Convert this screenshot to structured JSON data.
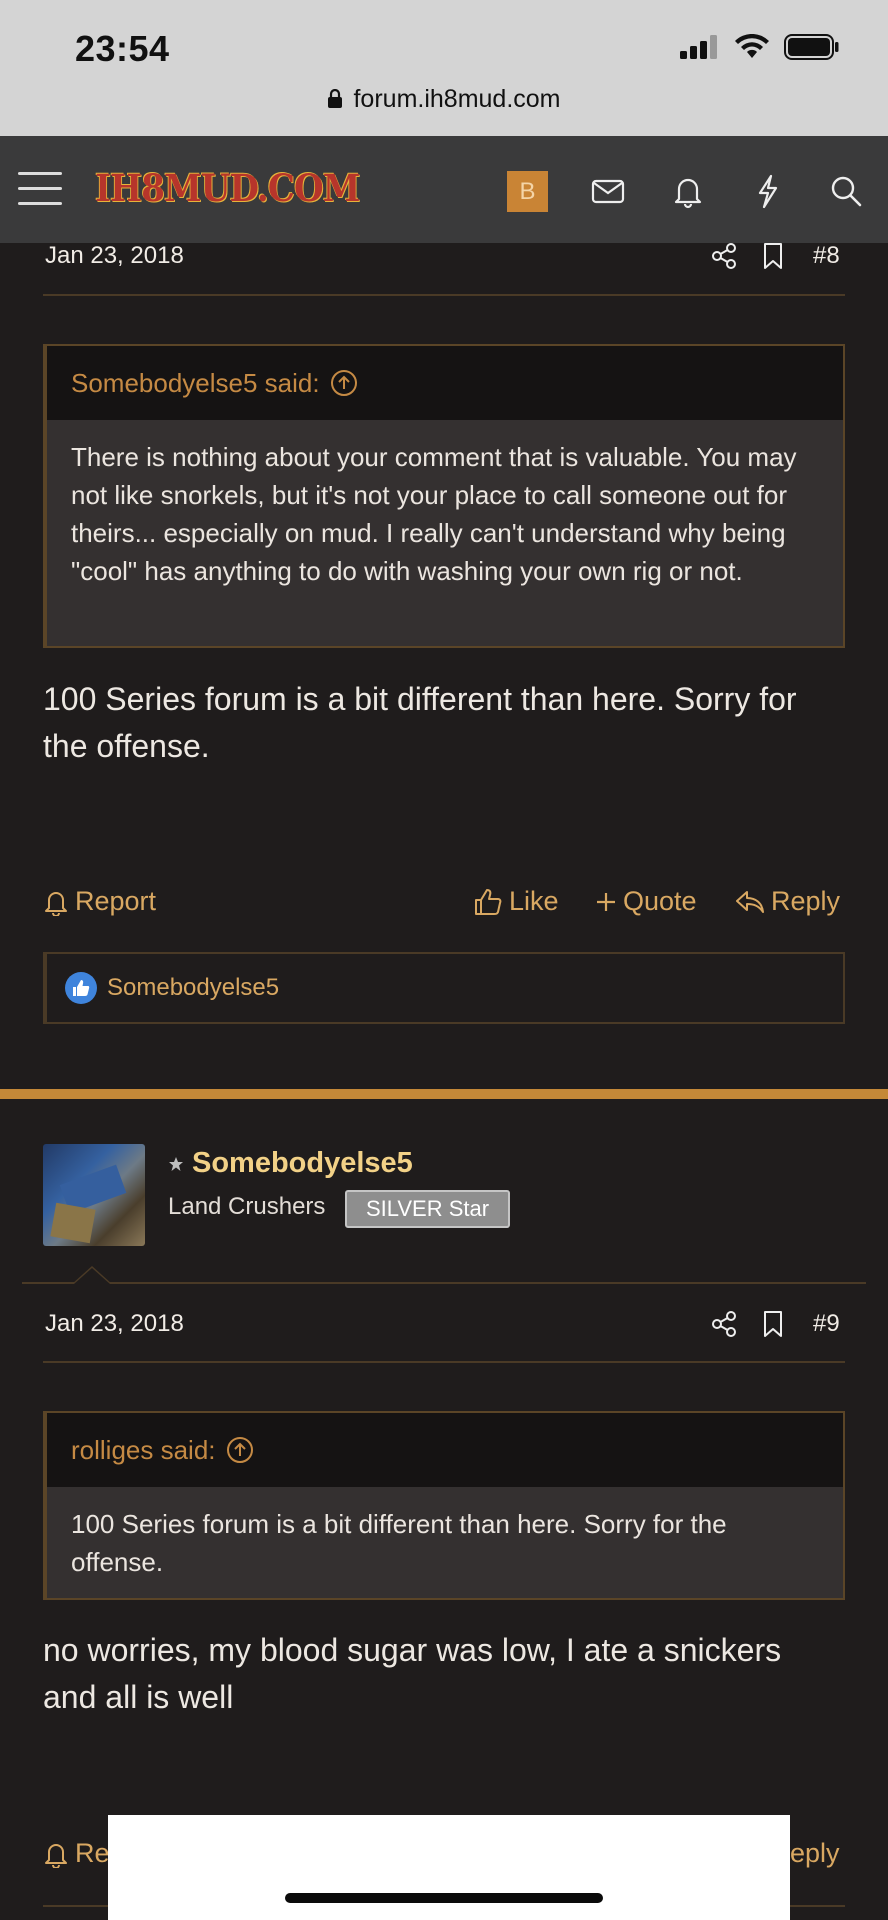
{
  "status_bar": {
    "time": "23:54",
    "url": "forum.ih8mud.com"
  },
  "navbar": {
    "logo": "IH8MUD.COM",
    "badge": "B"
  },
  "post8": {
    "date": "Jan 23, 2018",
    "number": "#8",
    "quote": {
      "author": "Somebodyelse5 said:",
      "text": "There is nothing about your comment that is valuable. You may not like snorkels, but it's not your place to call someone out for theirs... especially on mud. I really can't understand why being \"cool\" has anything to do with washing your own rig or not."
    },
    "body": "100 Series forum is a bit different than here. Sorry for the offense.",
    "actions": {
      "report": "Report",
      "like": "Like",
      "quote": "Quote",
      "reply": "Reply"
    },
    "liked_by": "Somebodyelse5"
  },
  "post9": {
    "username": "Somebodyelse5",
    "user_title": "Land Crushers",
    "badge": "SILVER Star",
    "date": "Jan 23, 2018",
    "number": "#9",
    "quote": {
      "author": "rolliges said:",
      "text": "100 Series forum is a bit different than here. Sorry for the offense."
    },
    "body": "no worries, my blood sugar was low, I ate a snickers and all is well",
    "actions": {
      "report_partial": "Re",
      "reply_partial": "eply"
    }
  },
  "colors": {
    "accent": "#c48838",
    "link": "#d9a862",
    "background": "#1f1c1c"
  }
}
